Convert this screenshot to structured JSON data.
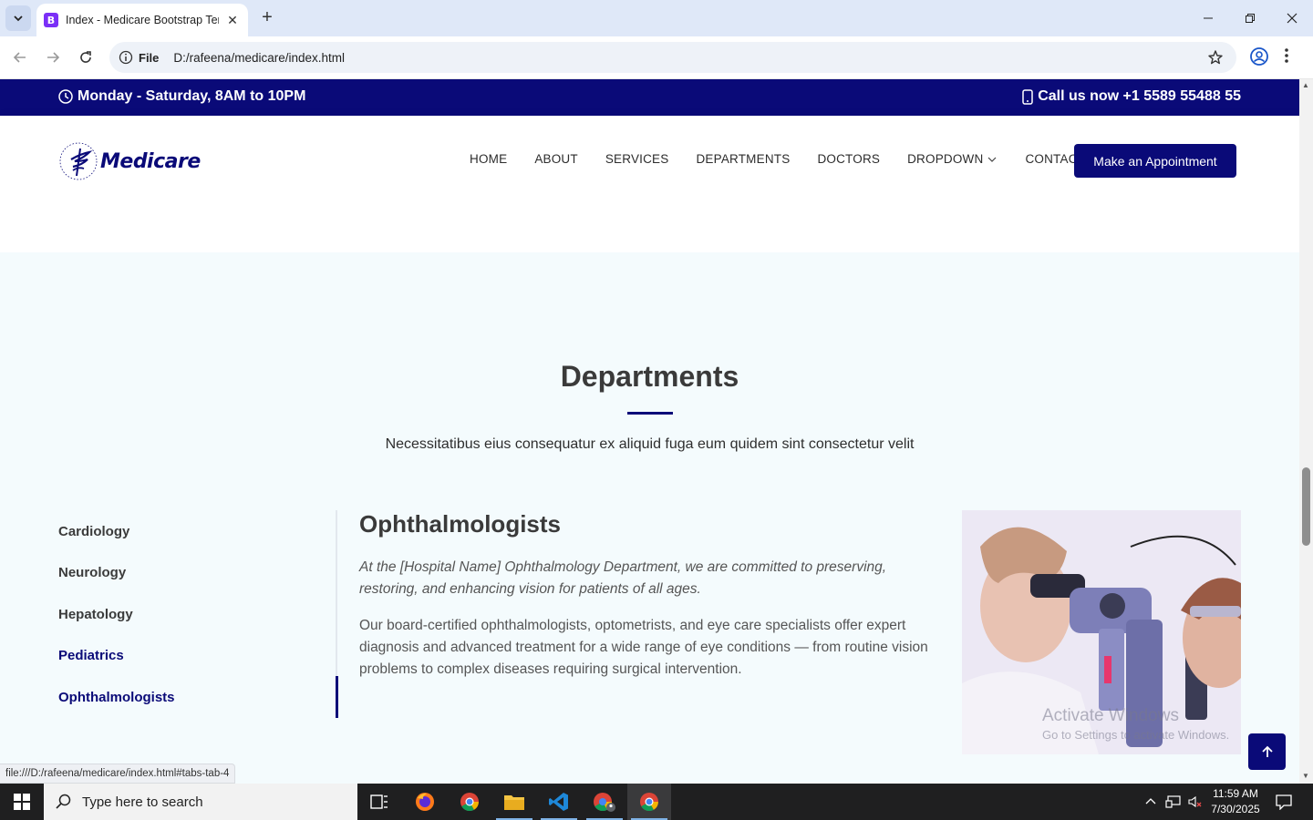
{
  "browser": {
    "tab_title": "Index - Medicare Bootstrap Template",
    "tab_favicon_letter": "B",
    "url_chip": "File",
    "url": "D:/rafeena/medicare/index.html",
    "status_url": "file:///D:/rafeena/medicare/index.html#tabs-tab-4"
  },
  "topbar": {
    "hours": "Monday - Saturday, 8AM to 10PM",
    "phone": "Call us now +1 5589 55488 55"
  },
  "header": {
    "logo_text": "Medicare",
    "nav": [
      "HOME",
      "ABOUT",
      "SERVICES",
      "DEPARTMENTS",
      "DOCTORS",
      "DROPDOWN",
      "CONTACT"
    ],
    "cta": "Make an Appointment"
  },
  "departments": {
    "title": "Departments",
    "subtitle": "Necessitatibus eius consequatur ex aliquid fuga eum quidem sint consectetur velit",
    "tabs": [
      "Cardiology",
      "Neurology",
      "Hepatology",
      "Pediatrics",
      "Ophthalmologists"
    ],
    "active_tab": "Ophthalmologists",
    "content": {
      "heading": "Ophthalmologists",
      "intro": "At the [Hospital Name] Ophthalmology Department, we are committed to preserving, restoring, and enhancing vision for patients of all ages.",
      "body": "Our board-certified ophthalmologists, optometrists, and eye care specialists offer expert diagnosis and advanced treatment for a wide range of eye conditions — from routine vision problems to complex diseases requiring surgical intervention."
    }
  },
  "watermark": {
    "line1": "Activate Windows",
    "line2": "Go to Settings to activate Windows."
  },
  "taskbar": {
    "search_placeholder": "Type here to search",
    "time": "11:59 AM",
    "date": "7/30/2025"
  },
  "colors": {
    "brand": "#0a0a78",
    "section_bg": "#f4fbfd"
  }
}
